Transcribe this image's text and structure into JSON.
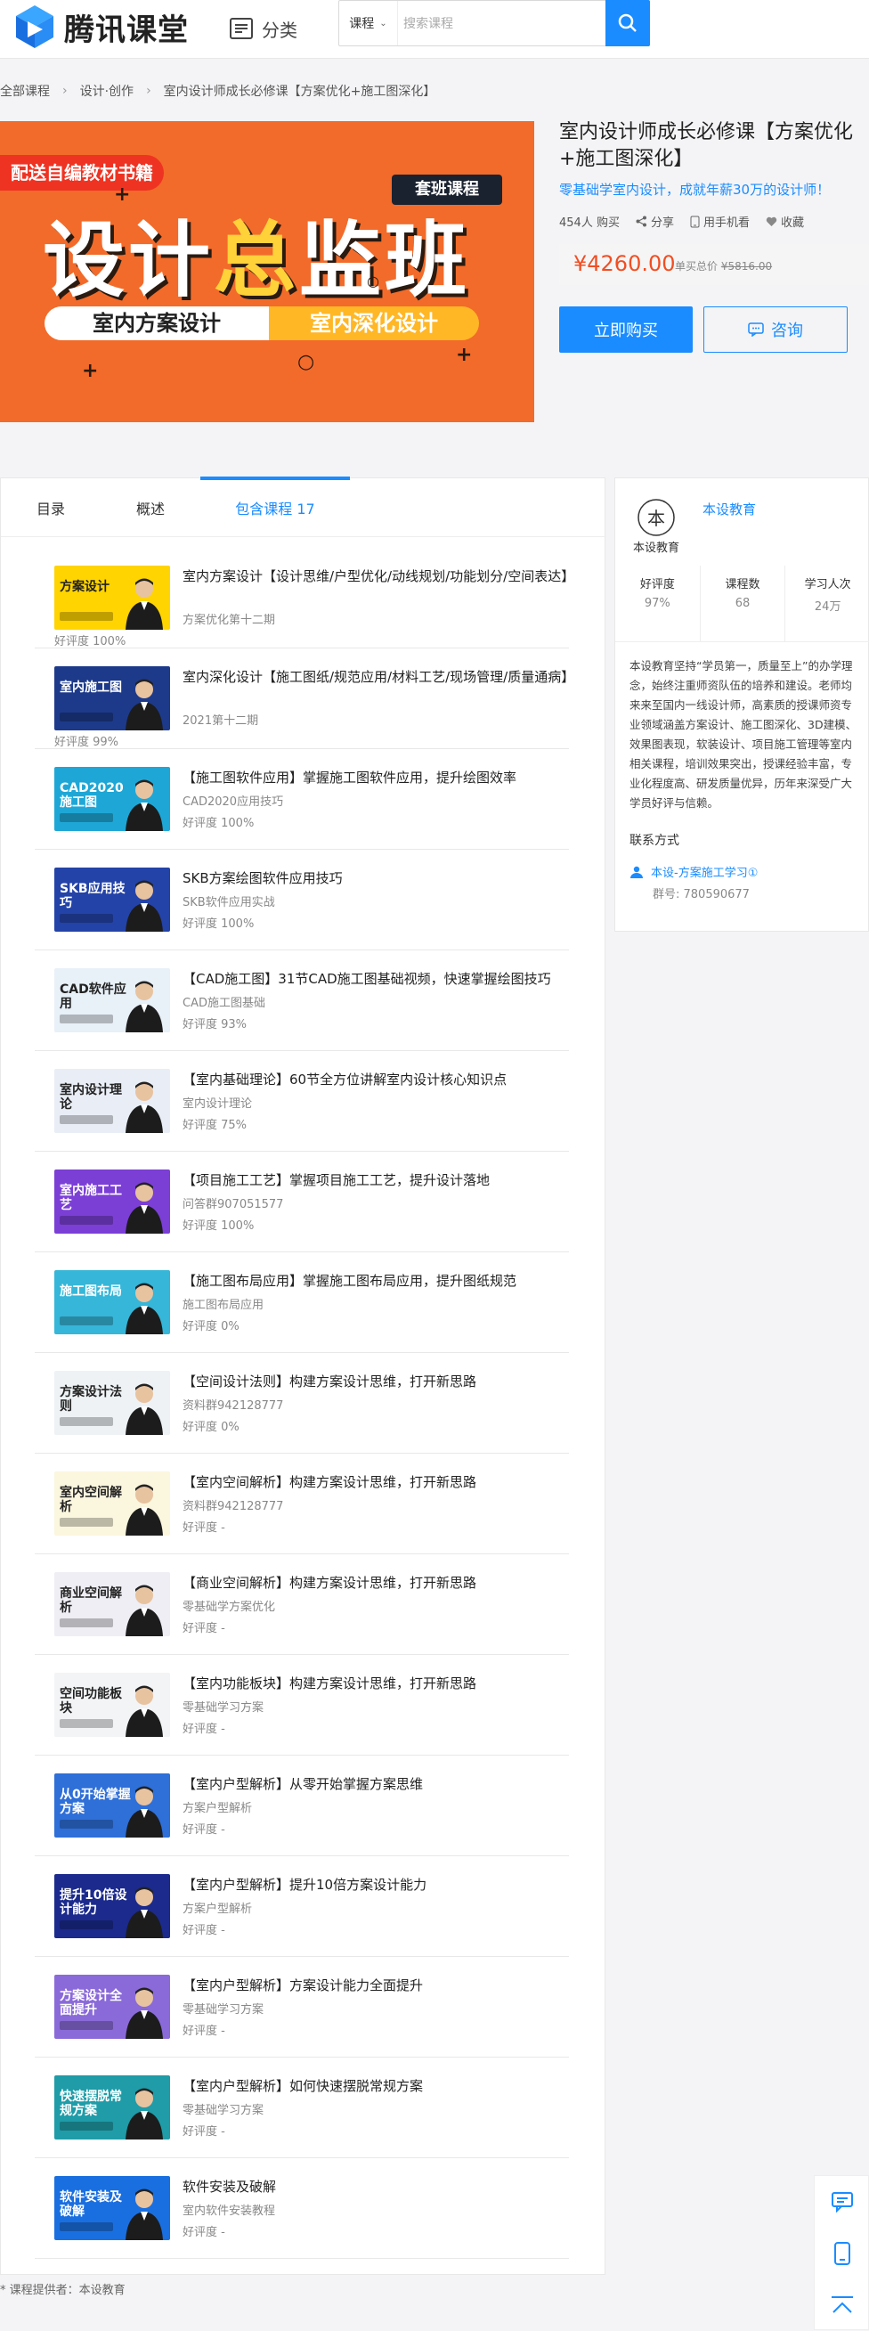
{
  "header": {
    "logo_text": "腾讯课堂",
    "category_label": "分类",
    "search_type": "课程",
    "search_placeholder": "搜索课程"
  },
  "breadcrumb": [
    "全部课程",
    "设计·创作",
    "室内设计师成长必修课【方案优化+施工图深化】"
  ],
  "banner": {
    "promo": "配送自编教材书籍",
    "tag": "套班课程",
    "title_a": "设计",
    "title_b": "总",
    "title_c": "监班",
    "pill_left": "室内方案设计",
    "pill_right": "室内深化设计"
  },
  "course": {
    "title": "室内设计师成长必修课【方案优化+施工图深化】",
    "subtitle": "零基础学室内设计，成就年薪30万的设计师！",
    "buyers": "454人 购买",
    "share": "分享",
    "mobile": "用手机看",
    "favorite": "收藏",
    "price": "¥4260.00",
    "orig_label": "单买总价",
    "orig_price": "¥5816.00",
    "buy_btn": "立即购买",
    "consult_btn": "咨询"
  },
  "tabs": [
    "目录",
    "概述",
    "包含课程 17"
  ],
  "courses": [
    {
      "title": "室内方案设计【设计思维/户型优化/动线规划/功能划分/空间表达】",
      "sub": "方案优化第十二期",
      "rate": "好评度 100%",
      "thumb_title": "方案设计",
      "bg": "#ffd400",
      "fg": "#222"
    },
    {
      "title": "室内深化设计【施工图纸/规范应用/材料工艺/现场管理/质量通病】",
      "sub": "2021第十二期",
      "rate": "好评度 99%",
      "thumb_title": "室内施工图",
      "bg": "#1d3a8a",
      "fg": "#fff"
    },
    {
      "title": "【施工图软件应用】掌握施工图软件应用，提升绘图效率",
      "sub": "CAD2020应用技巧",
      "rate": "好评度 100%",
      "thumb_title": "CAD2020 施工图",
      "bg": "#1ea7d6",
      "fg": "#fff"
    },
    {
      "title": "SKB方案绘图软件应用技巧",
      "sub": "SKB软件应用实战",
      "rate": "好评度 100%",
      "thumb_title": "SKB应用技巧",
      "bg": "#2443a8",
      "fg": "#fff"
    },
    {
      "title": "【CAD施工图】31节CAD施工图基础视频，快速掌握绘图技巧",
      "sub": "CAD施工图基础",
      "rate": "好评度 93%",
      "thumb_title": "CAD软件应用",
      "bg": "#e8f0f8",
      "fg": "#222"
    },
    {
      "title": "【室内基础理论】60节全方位讲解室内设计核心知识点",
      "sub": "室内设计理论",
      "rate": "好评度 75%",
      "thumb_title": "室内设计理论",
      "bg": "#e9eef6",
      "fg": "#222"
    },
    {
      "title": "【项目施工工艺】掌握项目施工工艺，提升设计落地",
      "sub": "问答群907051577",
      "rate": "好评度 100%",
      "thumb_title": "室内施工工艺",
      "bg": "#7b3fd6",
      "fg": "#fff"
    },
    {
      "title": "【施工图布局应用】掌握施工图布局应用，提升图纸规范",
      "sub": "施工图布局应用",
      "rate": "好评度 0%",
      "thumb_title": "施工图布局",
      "bg": "#36b6d8",
      "fg": "#fff"
    },
    {
      "title": "【空间设计法则】构建方案设计思维，打开新思路",
      "sub": "资料群942128777",
      "rate": "好评度 0%",
      "thumb_title": "方案设计法则",
      "bg": "#eef2f5",
      "fg": "#222"
    },
    {
      "title": "【室内空间解析】构建方案设计思维，打开新思路",
      "sub": "资料群942128777",
      "rate": "好评度 -",
      "thumb_title": "室内空间解析",
      "bg": "#fbf6de",
      "fg": "#222"
    },
    {
      "title": "【商业空间解析】构建方案设计思维，打开新思路",
      "sub": "零基础学方案优化",
      "rate": "好评度 -",
      "thumb_title": "商业空间解析",
      "bg": "#eeeef4",
      "fg": "#222"
    },
    {
      "title": "【室内功能板块】构建方案设计思维，打开新思路",
      "sub": "零基础学习方案",
      "rate": "好评度 -",
      "thumb_title": "空间功能板块",
      "bg": "#f2f4f6",
      "fg": "#222"
    },
    {
      "title": "【室内户型解析】从零开始掌握方案思维",
      "sub": "方案户型解析",
      "rate": "好评度 -",
      "thumb_title": "从0开始掌握方案",
      "bg": "#2e6fd8",
      "fg": "#fff"
    },
    {
      "title": "【室内户型解析】提升10倍方案设计能力",
      "sub": "方案户型解析",
      "rate": "好评度 -",
      "thumb_title": "提升10倍设计能力",
      "bg": "#1b2a8c",
      "fg": "#fff"
    },
    {
      "title": "【室内户型解析】方案设计能力全面提升",
      "sub": "零基础学习方案",
      "rate": "好评度 -",
      "thumb_title": "方案设计全面提升",
      "bg": "#8a6ad8",
      "fg": "#fff"
    },
    {
      "title": "【室内户型解析】如何快速摆脱常规方案",
      "sub": "零基础学习方案",
      "rate": "好评度 -",
      "thumb_title": "快速摆脱常规方案",
      "bg": "#1f9ca8",
      "fg": "#fff"
    },
    {
      "title": "软件安装及破解",
      "sub": "室内软件安装教程",
      "rate": "好评度 -",
      "thumb_title": "软件安装及破解",
      "bg": "#1a6fe0",
      "fg": "#fff"
    }
  ],
  "institution": {
    "logo_text": "本设教育",
    "name": "本设教育",
    "stats": [
      {
        "label": "好评度",
        "value": "97%"
      },
      {
        "label": "课程数",
        "value": "68"
      },
      {
        "label": "学习人次",
        "value": "24万"
      }
    ],
    "intro": "本设教育坚持“学员第一，质量至上”的办学理念，始终注重师资队伍的培养和建设。老师均来来至国内一线设计师，高素质的授课师资专业领域涵盖方案设计、施工图深化、3D建模、效果图表现，软装设计、项目施工管理等室内相关课程，培训效果突出，授课经验丰富，专业化程度高、研发质量优异，历年来深受广大学员好评与信赖。",
    "contact_heading": "联系方式",
    "contact_name": "本设-方案施工学习①",
    "contact_group": "群号: 780590677"
  },
  "footer_note": "* 课程提供者：本设教育"
}
